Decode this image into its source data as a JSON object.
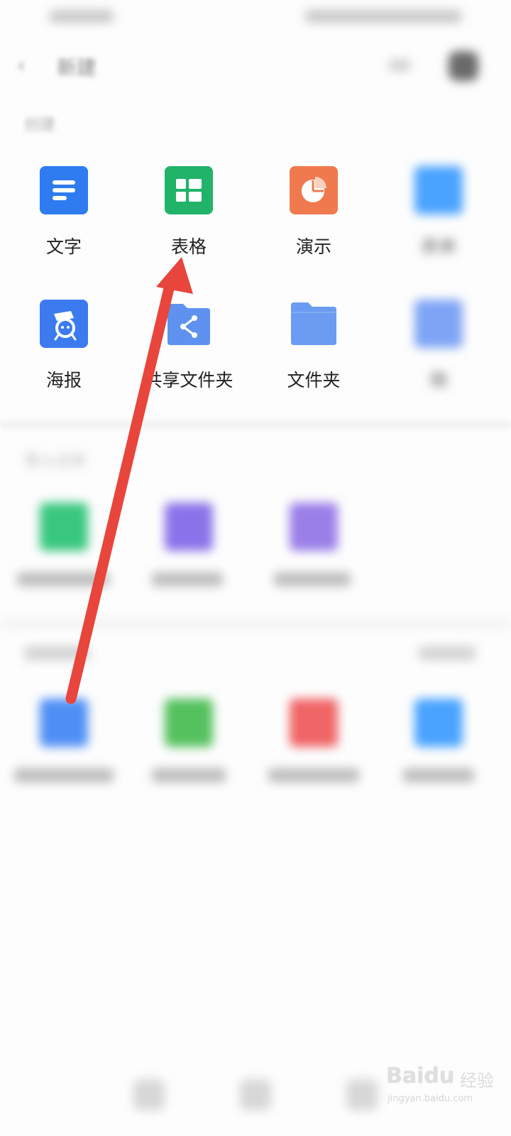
{
  "header": {
    "title": "新建"
  },
  "sections": {
    "create_label": "创建",
    "import_label": "导入文件"
  },
  "create_items": [
    {
      "label": "文字",
      "color": "#2f7bf0",
      "icon": "document-icon"
    },
    {
      "label": "表格",
      "color": "#21b36a",
      "icon": "spreadsheet-icon"
    },
    {
      "label": "演示",
      "color": "#f07a4d",
      "icon": "presentation-icon"
    },
    {
      "label": "表单",
      "color": "#4aa3ff",
      "icon": "form-icon"
    },
    {
      "label": "海报",
      "color": "#3b7bef",
      "icon": "poster-icon"
    },
    {
      "label": "共享文件夹",
      "color": "#5f92ef",
      "icon": "share-folder-icon"
    },
    {
      "label": "文件夹",
      "color": "#6b9cf2",
      "icon": "folder-icon"
    },
    {
      "label": "微",
      "color": "#7ea4f5",
      "icon": "wechat-folder-icon"
    }
  ],
  "import_items": [
    {
      "color": "#39c77f",
      "icon": "import-icon"
    },
    {
      "color": "#8a73ea",
      "icon": "import-icon"
    },
    {
      "color": "#9a7fe8",
      "icon": "import-icon"
    }
  ],
  "recent_items": [
    {
      "color": "#4f8ff5",
      "icon": "file-icon"
    },
    {
      "color": "#55c15e",
      "icon": "file-icon"
    },
    {
      "color": "#f06566",
      "icon": "file-icon"
    },
    {
      "color": "#49a3ff",
      "icon": "file-icon"
    }
  ],
  "annotation": {
    "arrow_color": "#e8453c"
  },
  "watermark": {
    "brand": "Baidu",
    "product": "经验",
    "url": "jingyan.baidu.com"
  }
}
